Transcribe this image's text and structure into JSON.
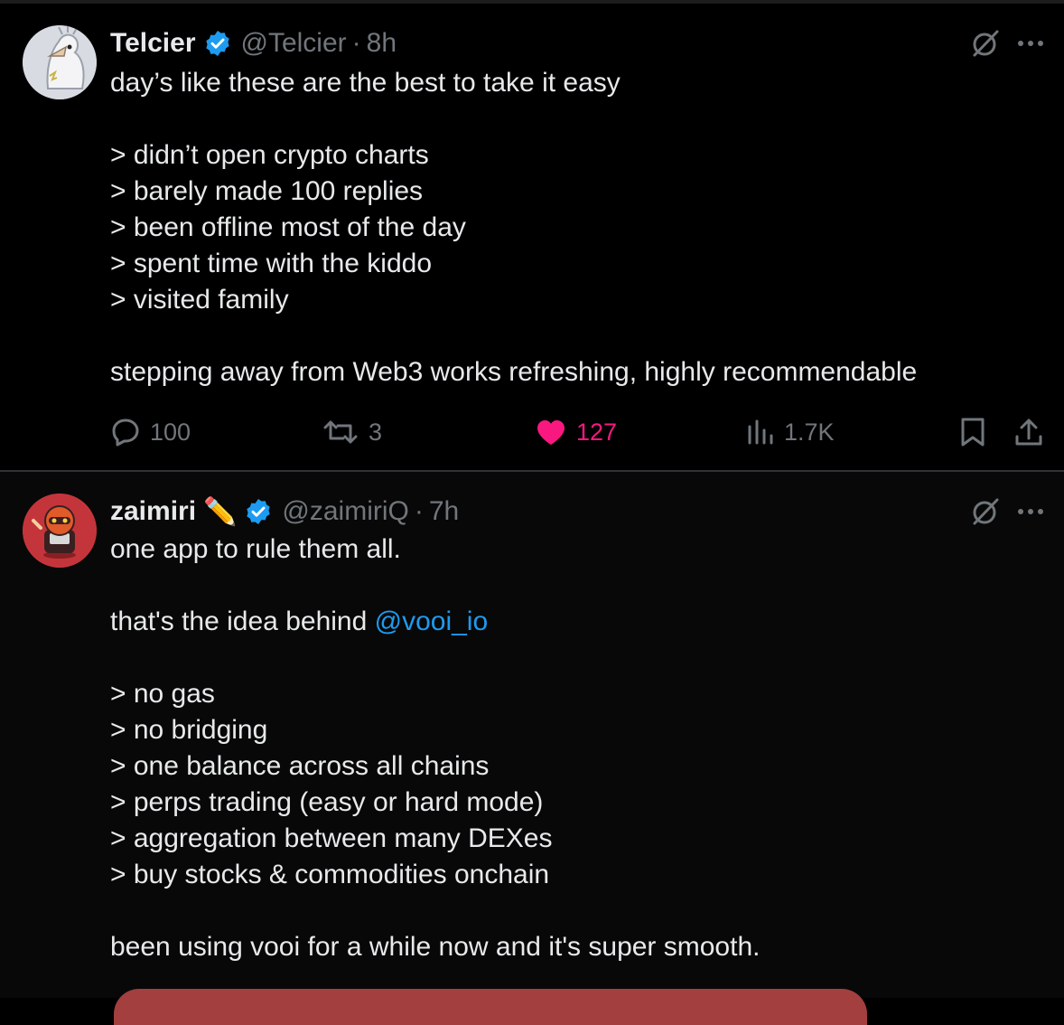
{
  "tweets": [
    {
      "name": "Telcier",
      "handle": "@Telcier",
      "separator": "·",
      "time": "8h",
      "lines": [
        "day’s like these are the best to take it easy",
        "",
        "> didn’t open crypto charts",
        "> barely made 100 replies",
        "> been offline most of the day",
        "> spent time with the kiddo",
        "> visited family",
        "",
        "stepping away from Web3 works refreshing, highly recommendable"
      ],
      "stats": {
        "replies": "100",
        "reposts": "3",
        "likes": "127",
        "views": "1.7K"
      },
      "liked": true
    },
    {
      "name": "zaimiri",
      "name_emoji": "✏️",
      "handle": "@zaimiriQ",
      "separator": "·",
      "time": "7h",
      "line1": "one app to rule them all.",
      "line2_prefix": "that's the idea behind ",
      "mention": "@vooi_io",
      "lines_rest": [
        "> no gas",
        "> no bridging",
        "> one balance across all chains",
        "> perps trading (easy or hard mode)",
        "> aggregation between many DEXes",
        "> buy stocks & commodities onchain",
        "",
        "been using vooi for a while now and it's super smooth."
      ]
    }
  ],
  "icons": {
    "verified": "verified-badge-icon",
    "grok": "grok-icon",
    "more": "more-icon",
    "reply": "reply-icon",
    "repost": "repost-icon",
    "like": "heart-icon",
    "views": "views-icon",
    "bookmark": "bookmark-icon",
    "share": "share-icon"
  },
  "colors": {
    "background": "#000000",
    "text": "#e7e9ea",
    "muted": "#71767b",
    "accent": "#1d9bf0",
    "like": "#f91880"
  }
}
